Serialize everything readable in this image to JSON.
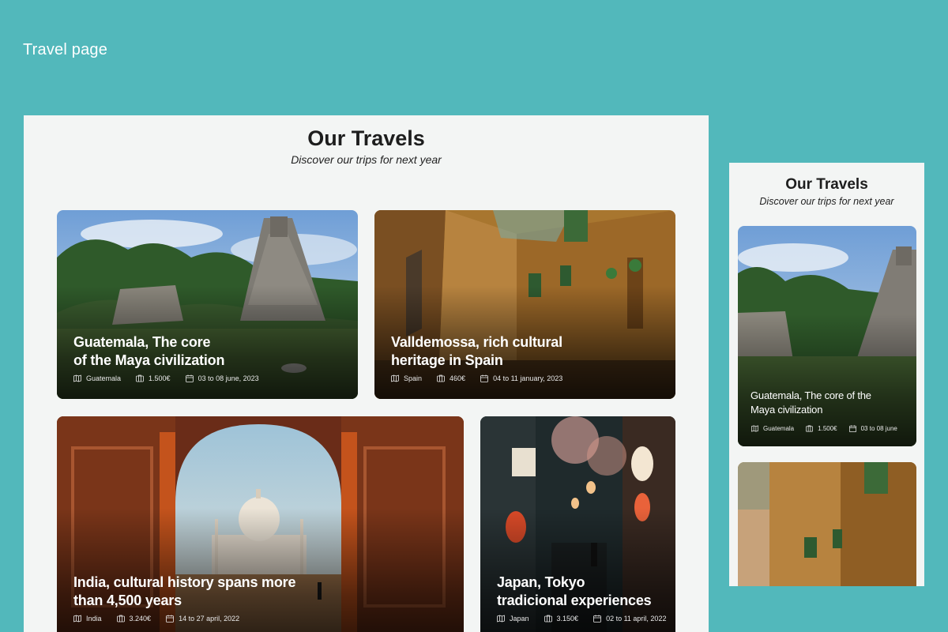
{
  "page_label": "Travel page",
  "section": {
    "title": "Our Travels",
    "subtitle": "Discover our trips for next year"
  },
  "cards": [
    {
      "title_line1": "Guatemala, The core",
      "title_line2": "of the Maya civilization",
      "country": "Guatemala",
      "price": "1.500€",
      "dates": "03 to 08 june, 2023"
    },
    {
      "title_line1": "Valldemossa, rich cultural",
      "title_line2": "heritage in Spain",
      "country": "Spain",
      "price": "460€",
      "dates": "04 to 11 january, 2023"
    },
    {
      "title_line1": "India, cultural history spans more",
      "title_line2": "than 4,500 years",
      "country": "India",
      "price": "3.240€",
      "dates": "14 to 27 april, 2022"
    },
    {
      "title_line1": "Japan, Tokyo",
      "title_line2": "tradicional experiences",
      "country": "Japan",
      "price": "3.150€",
      "dates": "02 to 11 april, 2022"
    }
  ],
  "mobile": {
    "title": "Our Travels",
    "subtitle": "Discover our trips for next year",
    "card": {
      "title_line1": "Guatemala, The core of the",
      "title_line2": "Maya civilization",
      "country": "Guatemala",
      "price": "1.500€",
      "dates": "03 to 08 june"
    }
  },
  "icons": {
    "location": "map-icon",
    "price": "wallet-icon",
    "dates": "calendar-icon"
  },
  "colors": {
    "background": "#52b8bb",
    "frame": "#f3f5f4",
    "title": "#1d1d1d"
  }
}
